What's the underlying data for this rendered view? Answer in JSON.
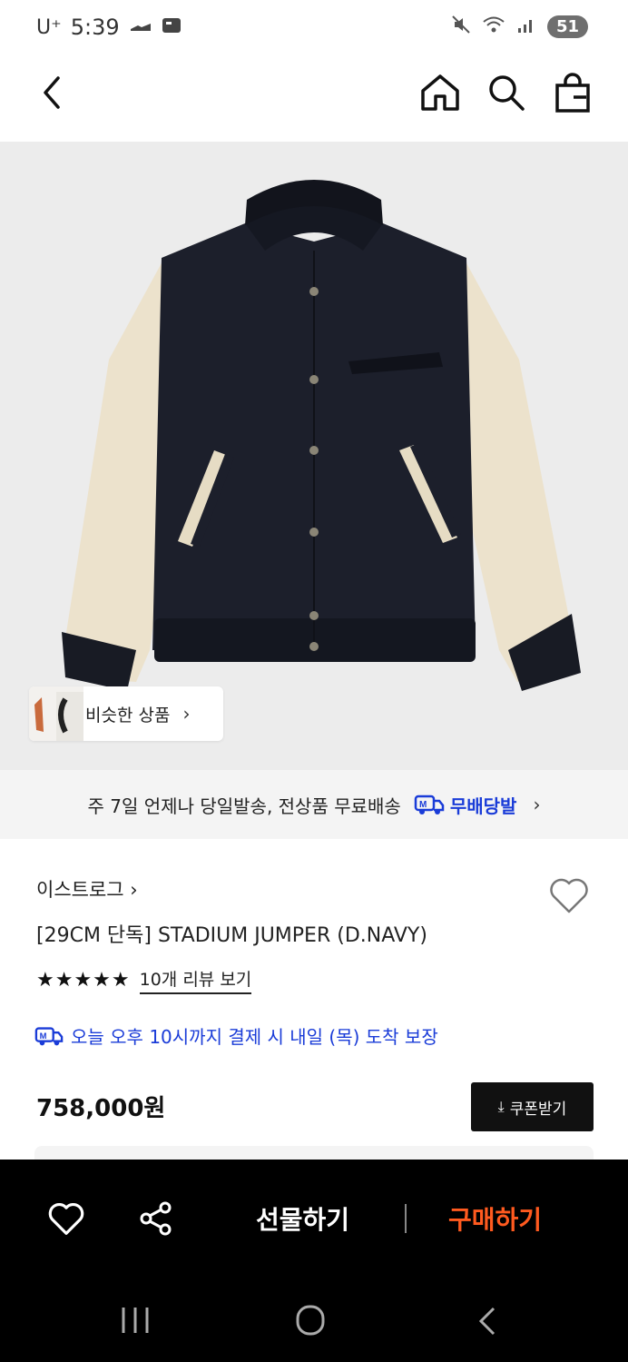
{
  "status": {
    "carrier": "U⁺",
    "time": "5:39",
    "battery": "51"
  },
  "hero": {
    "similar_label": "비슷한 상품"
  },
  "shipping": {
    "text": "주 7일 언제나 당일발송, 전상품 무료배송",
    "badge": "무배당발"
  },
  "product": {
    "brand": "이스트로그 ›",
    "title": "[29CM 단독] STADIUM JUMPER (D.NAVY)",
    "stars": "★★★★★",
    "rating_value": 5,
    "reviews": "10개 리뷰 보기",
    "delivery": "오늘 오후 10시까지 결제 시 내일 (목) 도착 보장",
    "price": "758,000원",
    "coupon": "쿠폰받기"
  },
  "bottom": {
    "gift": "선물하기",
    "buy": "구매하기"
  },
  "colors": {
    "accent_blue": "#1a3cd8",
    "buy_orange": "#ff5a1f",
    "navy": "#1a1e2a",
    "cream": "#eee4d0"
  }
}
